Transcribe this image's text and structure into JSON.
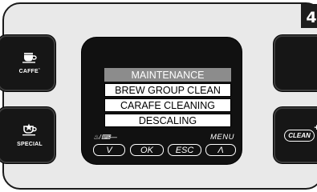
{
  "page_number": "4",
  "left_buttons": [
    {
      "label": "CAFFE`",
      "icon": "coffee-cup-icon"
    },
    {
      "label": "SPECIAL",
      "icon": "star-cup-icon"
    }
  ],
  "right_buttons": [
    {
      "label": "",
      "icon": "blank"
    },
    {
      "label": "CLEAN",
      "icon": "clean-plus-icon"
    }
  ],
  "display": {
    "menu_title": "MAINTENANCE",
    "menu_items": [
      "BREW GROUP CLEAN",
      "CARAFE CLEANING",
      "DESCALING"
    ],
    "left_hint": "♨/⌨—",
    "right_hint": "MENU",
    "nav": {
      "down": "V",
      "ok": "OK",
      "esc": "ESC",
      "up": "Λ"
    }
  }
}
